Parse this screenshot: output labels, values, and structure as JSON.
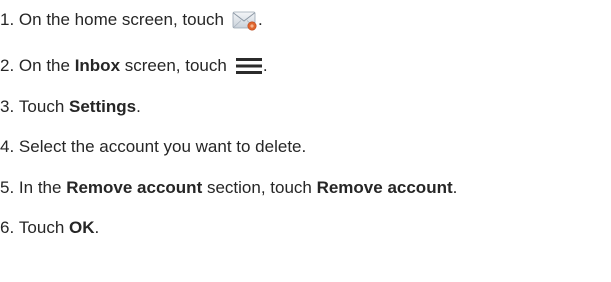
{
  "steps": [
    {
      "number": "1.",
      "text_before": "On the home screen, touch",
      "icon": "email-app-icon",
      "text_after": "."
    },
    {
      "number": "2.",
      "text_before": "On the ",
      "bold": "Inbox",
      "text_middle": " screen, touch",
      "icon": "menu-icon",
      "text_after": "."
    },
    {
      "number": "3.",
      "text_before": "Touch ",
      "bold": "Settings",
      "text_after": "."
    },
    {
      "number": "4.",
      "text_before": "Select the account you want to delete."
    },
    {
      "number": "5.",
      "text_before": "In the ",
      "bold": "Remove account",
      "text_middle": " section, touch ",
      "bold2": "Remove account",
      "text_after": "."
    },
    {
      "number": "6.",
      "text_before": "Touch ",
      "bold": "OK",
      "text_after": "."
    }
  ],
  "colors": {
    "text": "#262626",
    "menu_icon": "#2b2b2b"
  }
}
